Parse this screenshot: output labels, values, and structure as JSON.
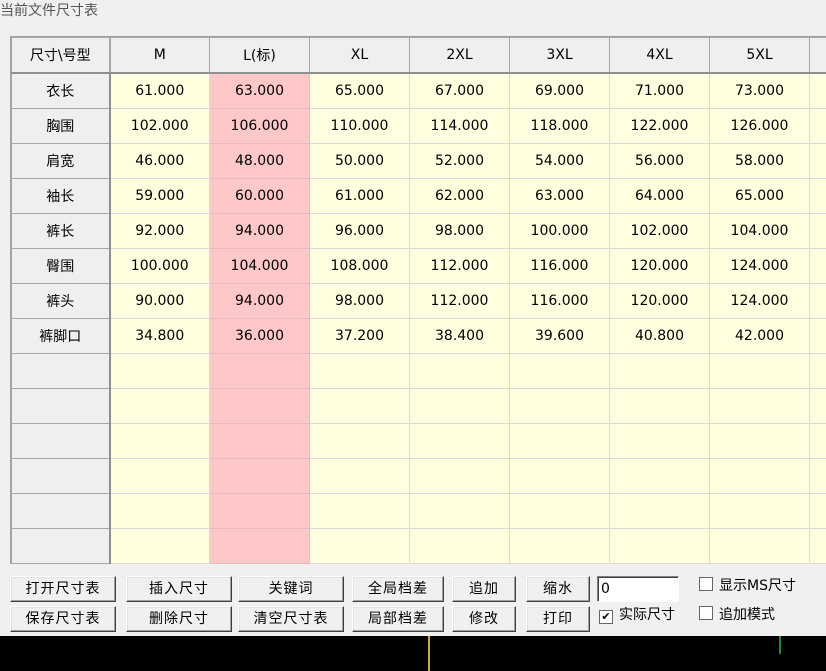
{
  "window": {
    "title": "当前文件尺寸表"
  },
  "grid": {
    "corner": "尺寸\\号型",
    "columns": [
      "M",
      "L(标)",
      "XL",
      "2XL",
      "3XL",
      "4XL",
      "5XL"
    ],
    "standard_column_index": 1,
    "rows": [
      {
        "label": "衣长",
        "values": [
          "61.000",
          "63.000",
          "65.000",
          "67.000",
          "69.000",
          "71.000",
          "73.000"
        ]
      },
      {
        "label": "胸围",
        "values": [
          "102.000",
          "106.000",
          "110.000",
          "114.000",
          "118.000",
          "122.000",
          "126.000"
        ]
      },
      {
        "label": "肩宽",
        "values": [
          "46.000",
          "48.000",
          "50.000",
          "52.000",
          "54.000",
          "56.000",
          "58.000"
        ]
      },
      {
        "label": "袖长",
        "values": [
          "59.000",
          "60.000",
          "61.000",
          "62.000",
          "63.000",
          "64.000",
          "65.000"
        ]
      },
      {
        "label": "裤长",
        "values": [
          "92.000",
          "94.000",
          "96.000",
          "98.000",
          "100.000",
          "102.000",
          "104.000"
        ]
      },
      {
        "label": "臀围",
        "values": [
          "100.000",
          "104.000",
          "108.000",
          "112.000",
          "116.000",
          "120.000",
          "124.000"
        ]
      },
      {
        "label": "裤头",
        "values": [
          "90.000",
          "94.000",
          "98.000",
          "112.000",
          "116.000",
          "120.000",
          "124.000"
        ]
      },
      {
        "label": "裤脚口",
        "values": [
          "34.800",
          "36.000",
          "37.200",
          "38.400",
          "39.600",
          "40.800",
          "42.000"
        ]
      }
    ],
    "empty_rows": 6,
    "colors": {
      "cell": "#ffffe0",
      "standard_cell": "#ffc8c8",
      "header": "#efefef"
    }
  },
  "buttons": {
    "open": "打开尺寸表",
    "insert": "插入尺寸",
    "keyword": "关键词",
    "global_grade": "全局档差",
    "append": "追加",
    "shrink": "缩水",
    "save": "保存尺寸表",
    "delete": "删除尺寸",
    "clear": "清空尺寸表",
    "local_grade": "局部档差",
    "modify": "修改",
    "print": "打印"
  },
  "shrink_input": {
    "value": "0"
  },
  "checkboxes": {
    "show_ms": {
      "label": "显示MS尺寸",
      "checked": false
    },
    "actual_size": {
      "label": "实际尺寸",
      "checked": true
    },
    "append_mode": {
      "label": "追加模式",
      "checked": false
    }
  }
}
